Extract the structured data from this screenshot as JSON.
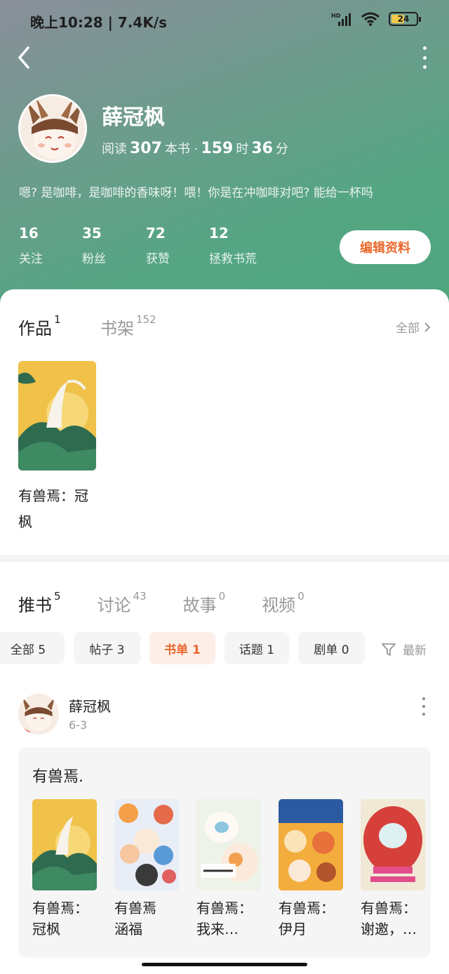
{
  "status_bar": {
    "time": "晚上10:28 | 7.4K/s",
    "battery": "24",
    "signal_label": "HD"
  },
  "profile": {
    "name": "薛冠枫",
    "reading_prefix": "阅读",
    "books_read": "307",
    "books_unit": "本书 ·",
    "hours": "159",
    "hours_unit": "时",
    "minutes": "36",
    "minutes_unit": "分",
    "bio": "嗯? 是咖啡，是咖啡的香味呀！喂！你是在冲咖啡对吧? 能给一杯吗",
    "edit_label": "编辑资料"
  },
  "stats": [
    {
      "num": "16",
      "label": "关注"
    },
    {
      "num": "35",
      "label": "粉丝"
    },
    {
      "num": "72",
      "label": "获赞"
    },
    {
      "num": "12",
      "label": "拯救书荒"
    }
  ],
  "works_tabs": [
    {
      "label": "作品",
      "count": "1",
      "active": true
    },
    {
      "label": "书架",
      "count": "152",
      "active": false
    }
  ],
  "all_label": "全部",
  "works": [
    {
      "title": "有兽焉：冠枫"
    }
  ],
  "sub_tabs": [
    {
      "label": "推书",
      "count": "5"
    },
    {
      "label": "讨论",
      "count": "43"
    },
    {
      "label": "故事",
      "count": "0"
    },
    {
      "label": "视频",
      "count": "0"
    }
  ],
  "chips": [
    {
      "label": "全部 5"
    },
    {
      "label": "帖子 3"
    },
    {
      "label": "书单 1"
    },
    {
      "label": "话题 1"
    },
    {
      "label": "剧单 0"
    }
  ],
  "filter_label": "最新",
  "post": {
    "author": "薛冠枫",
    "date": "6-3",
    "booklist_title": "有兽焉.",
    "books": [
      {
        "line1": "有兽焉：",
        "line2": "冠枫"
      },
      {
        "line1": "有兽焉",
        "line2": "涵福"
      },
      {
        "line1": "有兽焉：",
        "line2": "我来…"
      },
      {
        "line1": "有兽焉：",
        "line2": "伊月"
      },
      {
        "line1": "有兽焉：",
        "line2": "谢邀，…"
      }
    ]
  },
  "colors": {
    "accent": "#ec6a2e",
    "header_green": "#55a684"
  }
}
